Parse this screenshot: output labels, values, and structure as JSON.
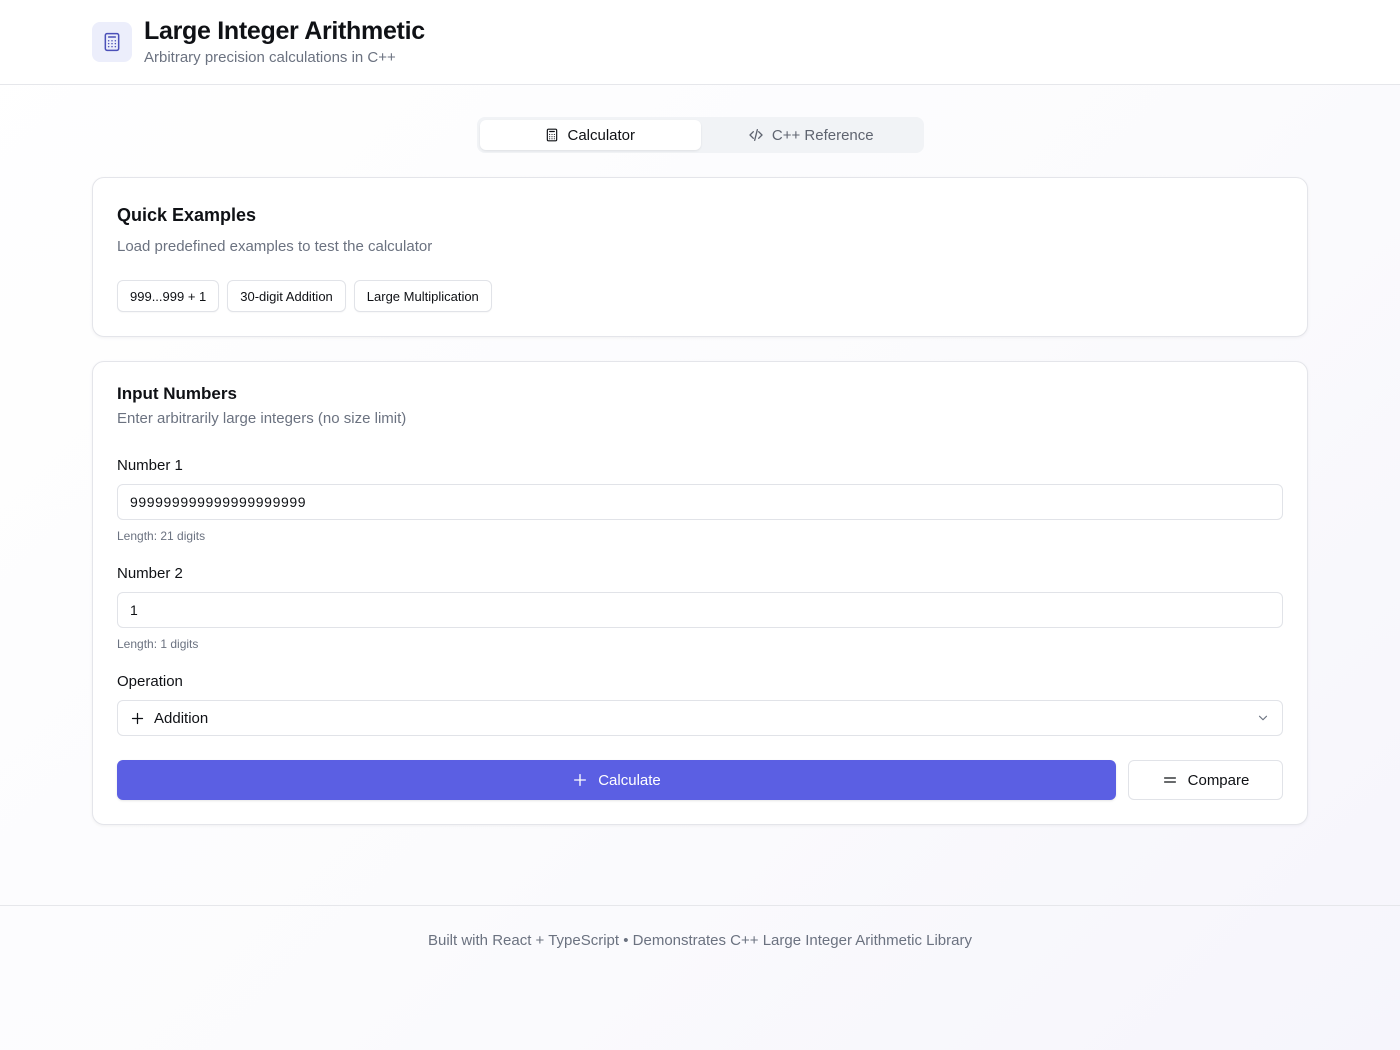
{
  "header": {
    "title": "Large Integer Arithmetic",
    "subtitle": "Arbitrary precision calculations in C++",
    "logo_icon": "calculator-icon"
  },
  "tabs": [
    {
      "label": "Calculator",
      "icon": "calculator-icon",
      "active": true
    },
    {
      "label": "C++ Reference",
      "icon": "code-icon",
      "active": false
    }
  ],
  "quick_examples": {
    "title": "Quick Examples",
    "description": "Load predefined examples to test the calculator",
    "buttons": [
      "999...999 + 1",
      "30-digit Addition",
      "Large Multiplication"
    ]
  },
  "input_numbers": {
    "title": "Input Numbers",
    "description": "Enter arbitrarily large integers (no size limit)",
    "number1": {
      "label": "Number 1",
      "value": "999999999999999999999",
      "hint": "Length: 21 digits"
    },
    "number2": {
      "label": "Number 2",
      "value": "1",
      "hint": "Length: 1 digits"
    },
    "operation": {
      "label": "Operation",
      "selected": "Addition",
      "icon": "plus-icon"
    },
    "calculate_label": "Calculate",
    "compare_label": "Compare"
  },
  "footer": {
    "text": "Built with React + TypeScript • Demonstrates C++ Large Integer Arithmetic Library"
  },
  "colors": {
    "accent": "#5b5fe3",
    "logo_bg": "#eceefb",
    "muted_text": "#6b7280",
    "border": "#e4e5ea"
  }
}
